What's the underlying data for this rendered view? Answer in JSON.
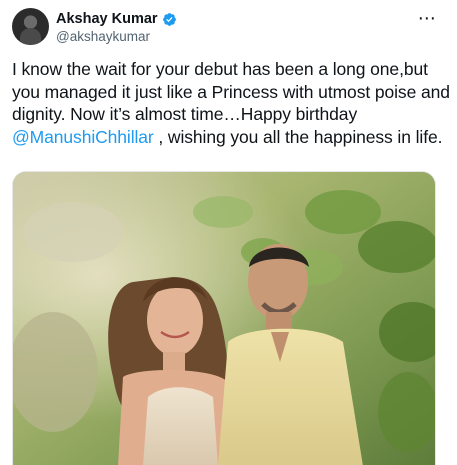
{
  "author": {
    "display_name": "Akshay Kumar",
    "handle": "@akshaykumar",
    "verified": true,
    "avatar_icon": "profile-avatar"
  },
  "menu": {
    "more_icon": "more-horizontal-icon",
    "more_glyph": "⋯"
  },
  "tweet": {
    "text_before_mention": "I know the wait for your debut has been a long one,but you managed it just like a Princess with utmost poise and dignity. Now it’s almost time…Happy birthday ",
    "mention": "@ManushiChhillar",
    "text_after_mention": " , wishing you all the happiness in life."
  },
  "media": {
    "type": "photo",
    "icon": "tweet-photo"
  },
  "colors": {
    "accent": "#1d9bf0",
    "text": "#0f1419",
    "secondary": "#536471"
  }
}
